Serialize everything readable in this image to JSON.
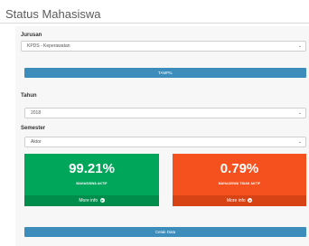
{
  "page": {
    "title": "Status Mahasiswa"
  },
  "form": {
    "jurusan_label": "Jurusan",
    "jurusan_value": "KPDS - Keperawatan",
    "tampil_label": "TAMPIL",
    "tahun_label": "Tahun",
    "tahun_value": "2018",
    "semester_label": "Semester",
    "semester_value": "Aktor"
  },
  "stats": {
    "aktif": {
      "value": "99.21%",
      "caption": "MAHASISWA AKTIF",
      "more": "More info",
      "color": "#00a65a"
    },
    "tidak_aktif": {
      "value": "0.79%",
      "caption": "MAHASISWA TIDAK AKTIF",
      "more": "More info",
      "color": "#f4511e"
    }
  },
  "actions": {
    "cetak_label": "Cetak Data"
  },
  "icons": {
    "select_chevron": "chevron-down-icon",
    "more_info": "arrow-circle-right-icon"
  }
}
